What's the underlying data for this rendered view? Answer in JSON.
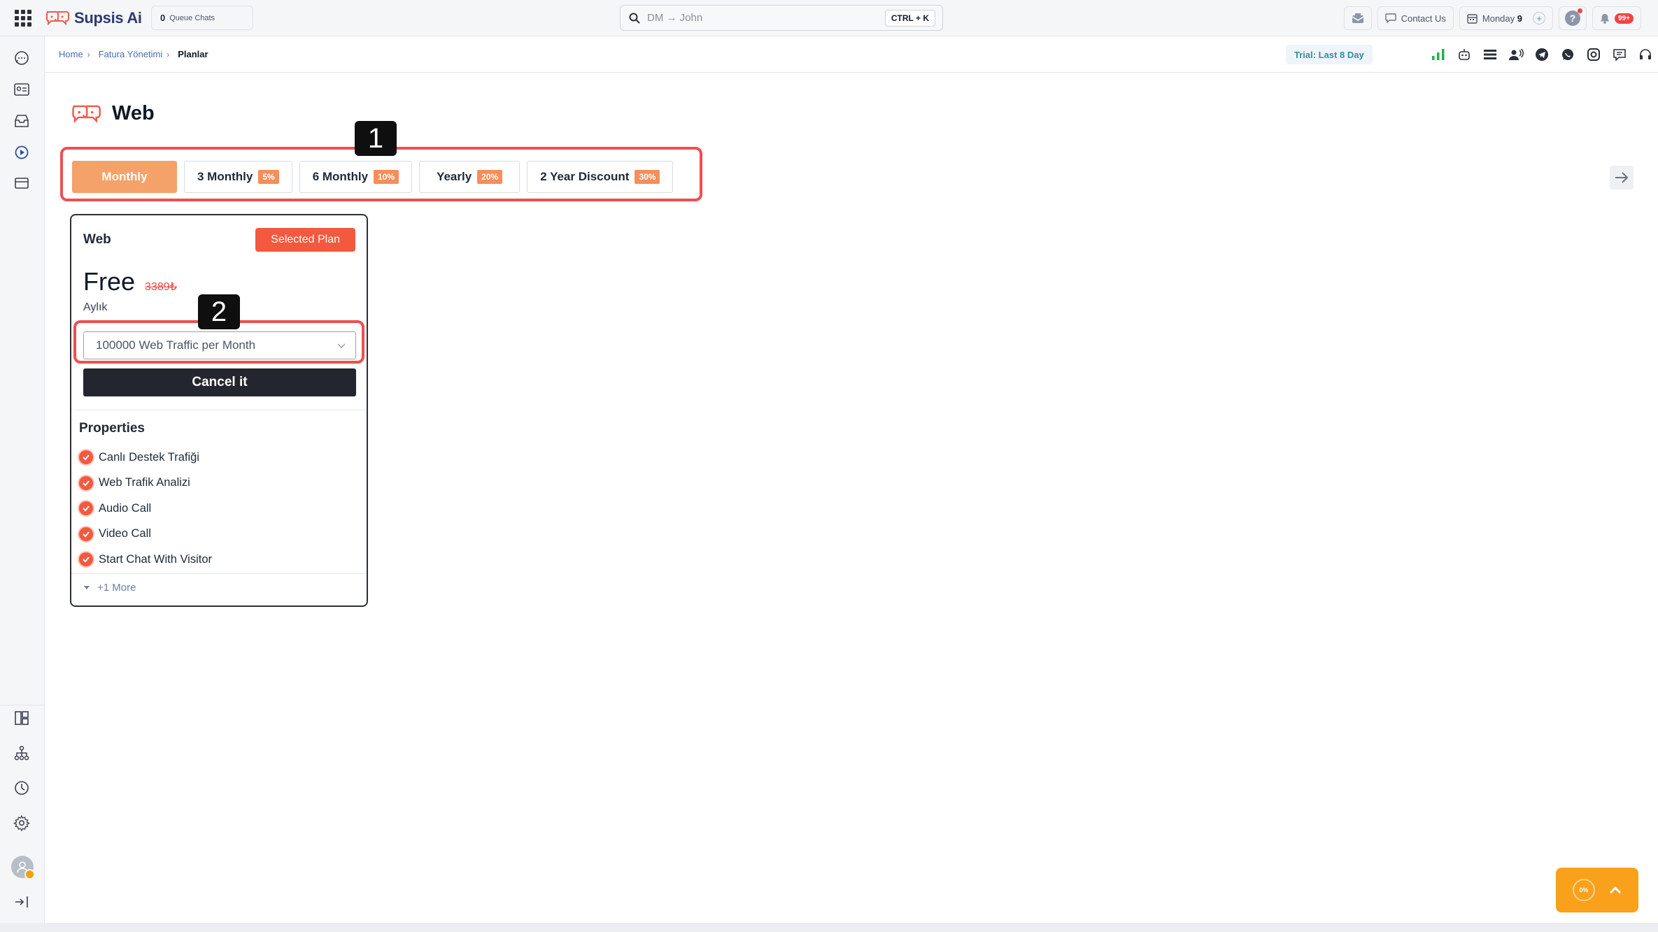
{
  "topbar": {
    "brand": "Supsis Ai",
    "queue_count": "0",
    "queue_label": "Queue Chats",
    "search_placeholder": "DM → John",
    "search_shortcut": "CTRL + K",
    "contact_label": "Contact Us",
    "calendar_label": "Monday",
    "calendar_day": "9",
    "help_label": "?",
    "notifications_badge": "99+"
  },
  "breadcrumb": {
    "items": [
      "Home",
      "Fatura Yönetimi"
    ],
    "separator": "›",
    "current": "Planlar"
  },
  "trial_label": "Trial: Last 8 Day",
  "page": {
    "title": "Web"
  },
  "annotations": {
    "one": "1",
    "two": "2"
  },
  "period_tabs": [
    {
      "label": "Monthly",
      "discount": "",
      "active": true
    },
    {
      "label": "3 Monthly",
      "discount": "5%",
      "active": false
    },
    {
      "label": "6 Monthly",
      "discount": "10%",
      "active": false
    },
    {
      "label": "Yearly",
      "discount": "20%",
      "active": false
    },
    {
      "label": "2 Year Discount",
      "discount": "30%",
      "active": false
    }
  ],
  "plan_card": {
    "name": "Web",
    "selected_label": "Selected Plan",
    "price": "Free",
    "old_price": "3389₺",
    "period": "Aylık",
    "traffic_option": "100000 Web Traffic per Month",
    "cancel_label": "Cancel it",
    "properties_title": "Properties",
    "properties": [
      "Canlı Destek Trafiği",
      "Web Trafik Analizi",
      "Audio Call",
      "Video Call",
      "Start Chat With Visitor"
    ],
    "more_label": "+1 More"
  },
  "progress_widget": {
    "percent": "0%"
  },
  "colors": {
    "accent": "#f2593f",
    "tab_active": "#f4a26a",
    "annotation": "#ef4f4f",
    "brand_text": "#2d3a6e",
    "widget": "#f9a11b"
  }
}
